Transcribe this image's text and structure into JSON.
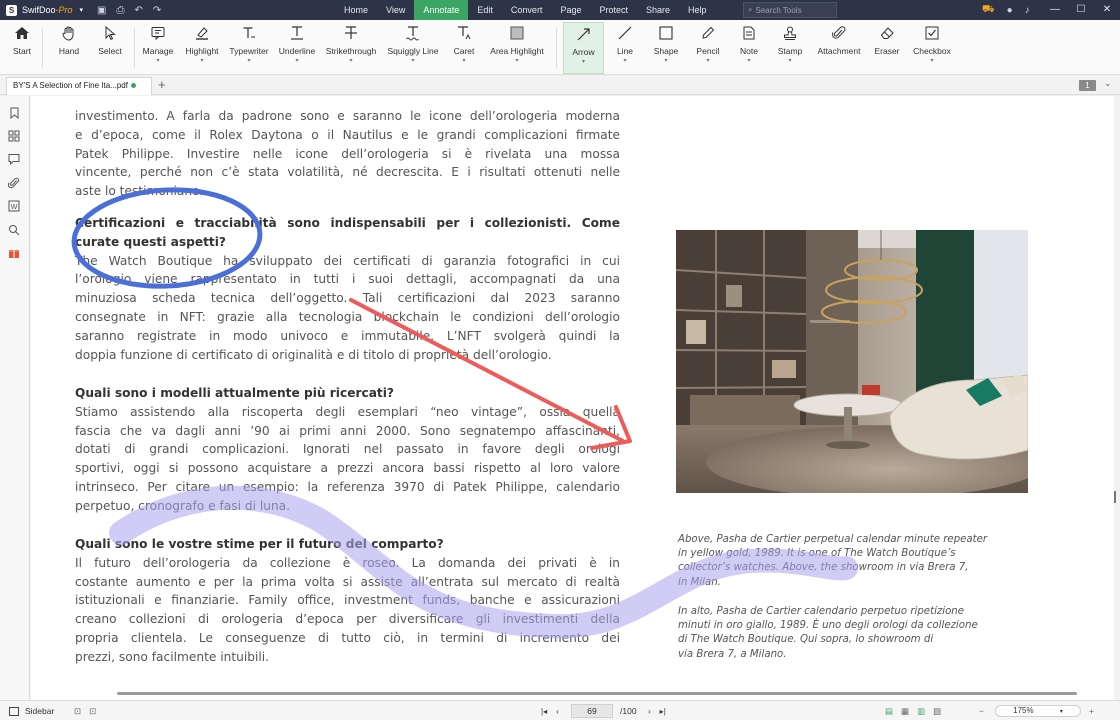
{
  "app": {
    "name": "SwifDoo",
    "edition": "-Pro",
    "search_placeholder": "Search Tools"
  },
  "menu": [
    "Home",
    "View",
    "Annotate",
    "Edit",
    "Convert",
    "Page",
    "Protect",
    "Share",
    "Help"
  ],
  "active_menu": "Annotate",
  "toolbar": {
    "tools": [
      {
        "label": "Start",
        "icon": "home-icon"
      },
      {
        "label": "Hand",
        "icon": "hand-icon"
      },
      {
        "label": "Select",
        "icon": "cursor-icon"
      },
      {
        "label": "Manage",
        "icon": "manage-icon"
      },
      {
        "label": "Highlight",
        "icon": "highlight-icon"
      },
      {
        "label": "Typewriter",
        "icon": "typewriter-icon"
      },
      {
        "label": "Underline",
        "icon": "underline-icon"
      },
      {
        "label": "Strikethrough",
        "icon": "strikethrough-icon"
      },
      {
        "label": "Squiggly Line",
        "icon": "squiggly-icon"
      },
      {
        "label": "Caret",
        "icon": "caret-icon"
      },
      {
        "label": "Area Highlight",
        "icon": "area-highlight-icon"
      },
      {
        "label": "Arrow",
        "icon": "arrow-icon"
      },
      {
        "label": "Line",
        "icon": "line-icon"
      },
      {
        "label": "Shape",
        "icon": "shape-icon"
      },
      {
        "label": "Pencil",
        "icon": "pencil-icon"
      },
      {
        "label": "Note",
        "icon": "note-icon"
      },
      {
        "label": "Stamp",
        "icon": "stamp-icon"
      },
      {
        "label": "Attachment",
        "icon": "attachment-icon"
      },
      {
        "label": "Eraser",
        "icon": "eraser-icon"
      },
      {
        "label": "Checkbox",
        "icon": "checkbox-icon"
      }
    ],
    "active_tool": "Arrow"
  },
  "tab": {
    "title": "BY'S A Selection of Fine Ita...pdf",
    "page_badge": "1"
  },
  "document": {
    "para1": [
      "investimento. A farla da padrone sono e saranno le icone dell’orologeria moderna",
      "e d’epoca, come il Rolex Daytona o il Nautilus e le grandi complicazioni firmate",
      "Patek Philippe. Investire nelle icone dell’orologeria si è rivelata una mossa",
      "vincente, perché non c’è stata volatilità, né decrescita. E i risultati ottenuti nelle",
      "aste lo testimoniano."
    ],
    "heading1": [
      "Certificazioni e tracciabilità sono indispensabili per i collezionisti. Come",
      "curate questi aspetti?"
    ],
    "para2": [
      "The Watch Boutique ha sviluppato dei certificati di garanzia fotografici in cui",
      "l’orologio viene rappresentato in tutti i suoi dettagli, accompagnati da una",
      "minuziosa scheda tecnica dell’oggetto. Tali certificazioni dal 2023 saranno",
      "consegnate in NFT: grazie alla tecnologia blockchain le condizioni dell’orologio",
      "saranno registrate in modo univoco e immutabile. L’NFT svolgerà quindi la",
      "doppia funzione di certificato di originalità e di titolo di proprietà dell’orologio."
    ],
    "heading2": "Quali sono i modelli attualmente più ricercati?",
    "para3": [
      "Stiamo assistendo alla riscoperta degli esemplari “neo vintage”, ossia quella",
      "fascia che va dagli anni ’90 ai primi anni 2000. Sono segnatempo affascinanti,",
      "dotati di grandi complicazioni. Ignorati nel passato in favore degli orologi",
      "sportivi, oggi si possono acquistare a prezzi ancora bassi rispetto al loro valore",
      "intrinseco. Per citare un esempio: la referenza 3970 di Patek Philippe, calendario",
      "perpetuo, cronografo e fasi di luna."
    ],
    "heading3": "Quali sono le vostre stime per il futuro del comparto?",
    "para4": [
      "Il futuro dell’orologeria da collezione è roseo. La domanda dei privati è in",
      "costante aumento e per la prima volta si assiste all’entrata sul mercato di realtà",
      "istituzionali e finanziarie. Family office, investment funds, banche e assicurazioni",
      "creano collezioni di orologeria d’epoca per diversificare gli investimenti della",
      "propria clientela. Le conseguenze di tutto ciò, in termini di incremento dei",
      "prezzi, sono facilmente intuibili."
    ],
    "caption_en": [
      "Above, Pasha de Cartier perpetual calendar minute repeater",
      "in yellow gold, 1989. It is one of The Watch Boutique’s",
      "collector’s watches. Above, the showroom in via Brera 7,",
      "in Milan."
    ],
    "caption_it": [
      "In alto, Pasha de Cartier calendario perpetuo ripetizione",
      "minuti in oro giallo, 1989. È uno degli orologi da collezione",
      "di The Watch Boutique. Qui sopra, lo showroom di",
      "via Brera 7, a Milano."
    ]
  },
  "annotations": {
    "ellipse_color": "#4a6fd8",
    "arrow_color": "#ee5b5b",
    "squiggle_color": "#a9a3ee"
  },
  "statusbar": {
    "sidebar_label": "Sidebar",
    "current_page": "69",
    "total_pages": "/100",
    "zoom": "175%"
  }
}
